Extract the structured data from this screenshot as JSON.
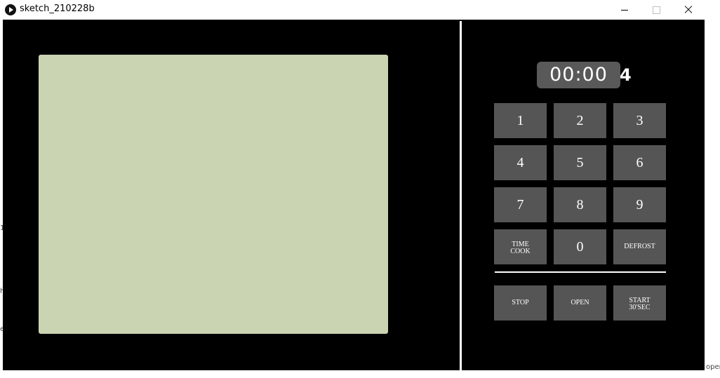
{
  "window": {
    "title": "sketch_210228b"
  },
  "colors": {
    "canvas_bg": "#000000",
    "screen": "#cad4b2",
    "key_bg": "#555555",
    "display_bg": "#595959",
    "text": "#ffffff"
  },
  "display": {
    "time": "00:00",
    "overflow_digit": "4"
  },
  "keypad": {
    "k1": "1",
    "k2": "2",
    "k3": "3",
    "k4": "4",
    "k5": "5",
    "k6": "6",
    "k7": "7",
    "k8": "8",
    "k9": "9",
    "time_cook": "TIME\nCOOK",
    "k0": "0",
    "defrost": "DEFROST",
    "stop": "STOP",
    "open": "OPEN",
    "start": "START\n30'SEC"
  },
  "background_fragments": {
    "left1": "1",
    "left2": "h",
    "left3": "e",
    "right": "oper"
  }
}
